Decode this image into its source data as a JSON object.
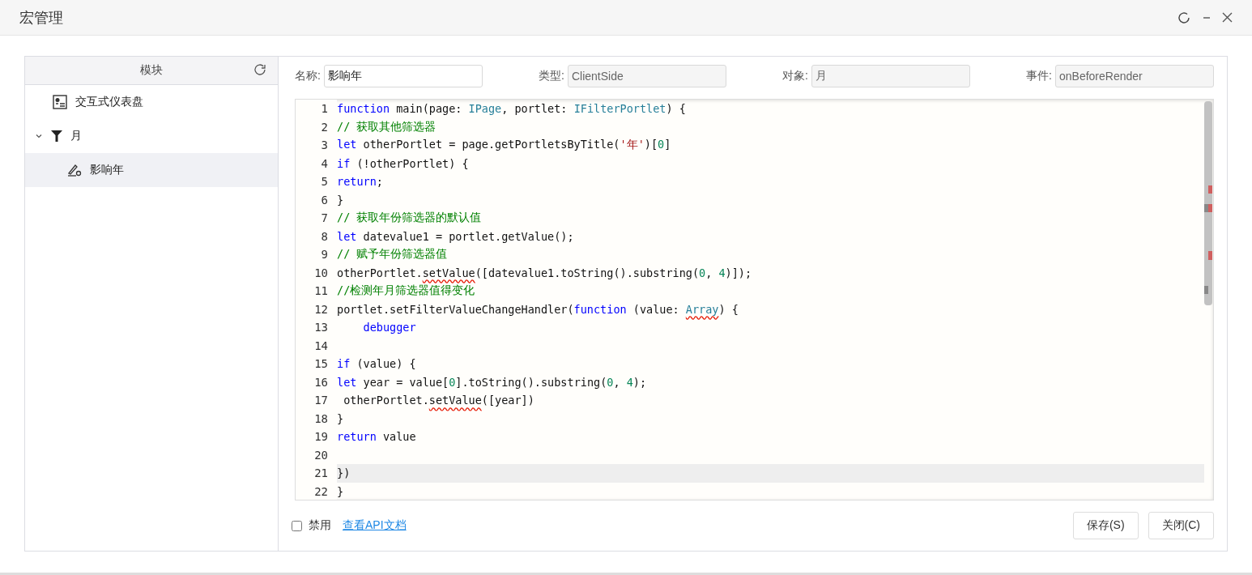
{
  "window": {
    "title": "宏管理"
  },
  "module_panel": {
    "header": "模块",
    "tree": [
      {
        "label": "交互式仪表盘",
        "kind": "dashboard",
        "selected": false
      },
      {
        "label": "月",
        "kind": "filter",
        "selected": false,
        "expanded": true,
        "children": [
          {
            "label": "影响年",
            "kind": "macro",
            "selected": true
          }
        ]
      }
    ]
  },
  "fields": [
    {
      "label": "名称:",
      "value": "影响年",
      "disabled": false
    },
    {
      "label": "类型:",
      "value": "ClientSide",
      "disabled": true
    },
    {
      "label": "对象:",
      "value": "月",
      "disabled": true
    },
    {
      "label": "事件:",
      "value": "onBeforeRender",
      "disabled": true
    }
  ],
  "code_lines": [
    {
      "number": "1",
      "current": false,
      "tokens": [
        {
          "kind": "keyword",
          "text": "function"
        },
        {
          "kind": "plain",
          "text": " main(page: "
        },
        {
          "kind": "type",
          "text": "IPage"
        },
        {
          "kind": "plain",
          "text": ", portlet: "
        },
        {
          "kind": "type",
          "text": "IFilterPortlet"
        },
        {
          "kind": "plain",
          "text": ") {"
        }
      ]
    },
    {
      "number": "2",
      "current": false,
      "tokens": [
        {
          "kind": "comment",
          "text": "// 获取其他筛选器"
        }
      ]
    },
    {
      "number": "3",
      "current": false,
      "tokens": [
        {
          "kind": "keyword",
          "text": "let"
        },
        {
          "kind": "plain",
          "text": " otherPortlet = page.getPortletsByTitle("
        },
        {
          "kind": "string",
          "text": "'年'"
        },
        {
          "kind": "plain",
          "text": ")["
        },
        {
          "kind": "number",
          "text": "0"
        },
        {
          "kind": "plain",
          "text": "]"
        }
      ]
    },
    {
      "number": "4",
      "current": false,
      "tokens": [
        {
          "kind": "keyword",
          "text": "if"
        },
        {
          "kind": "plain",
          "text": " (!otherPortlet) {"
        }
      ]
    },
    {
      "number": "5",
      "current": false,
      "tokens": [
        {
          "kind": "keyword",
          "text": "return"
        },
        {
          "kind": "plain",
          "text": ";"
        }
      ]
    },
    {
      "number": "6",
      "current": false,
      "tokens": [
        {
          "kind": "plain",
          "text": "}"
        }
      ]
    },
    {
      "number": "7",
      "current": false,
      "tokens": [
        {
          "kind": "comment",
          "text": "// 获取年份筛选器的默认值"
        }
      ]
    },
    {
      "number": "8",
      "current": false,
      "tokens": [
        {
          "kind": "keyword",
          "text": "let"
        },
        {
          "kind": "plain",
          "text": " datevalue1 = portlet.getValue();"
        }
      ]
    },
    {
      "number": "9",
      "current": false,
      "tokens": [
        {
          "kind": "comment",
          "text": "// 赋予年份筛选器值"
        }
      ]
    },
    {
      "number": "10",
      "current": false,
      "tokens": [
        {
          "kind": "plain",
          "text": "otherPortlet."
        },
        {
          "kind": "error",
          "text": "setValue"
        },
        {
          "kind": "plain",
          "text": "([datevalue1.toString().substring("
        },
        {
          "kind": "number",
          "text": "0"
        },
        {
          "kind": "plain",
          "text": ", "
        },
        {
          "kind": "number",
          "text": "4"
        },
        {
          "kind": "plain",
          "text": ")]);"
        }
      ]
    },
    {
      "number": "11",
      "current": false,
      "tokens": [
        {
          "kind": "comment",
          "text": "//检测年月筛选器值得变化"
        }
      ]
    },
    {
      "number": "12",
      "current": false,
      "tokens": [
        {
          "kind": "plain",
          "text": "portlet.setFilterValueChangeHandler("
        },
        {
          "kind": "keyword",
          "text": "function"
        },
        {
          "kind": "plain",
          "text": " (value: "
        },
        {
          "kind": "type_error",
          "text": "Array"
        },
        {
          "kind": "plain",
          "text": ") {"
        }
      ]
    },
    {
      "number": "13",
      "current": false,
      "indented": true,
      "tokens": [
        {
          "kind": "keyword",
          "text": "debugger"
        }
      ]
    },
    {
      "number": "14",
      "current": false
    },
    {
      "number": "15",
      "current": false,
      "tokens": [
        {
          "kind": "keyword",
          "text": "if"
        },
        {
          "kind": "plain",
          "text": " (value) {"
        }
      ]
    },
    {
      "number": "16",
      "current": false,
      "tokens": [
        {
          "kind": "keyword",
          "text": "let"
        },
        {
          "kind": "plain",
          "text": " year = value["
        },
        {
          "kind": "number",
          "text": "0"
        },
        {
          "kind": "plain",
          "text": "].toString().substring("
        },
        {
          "kind": "number",
          "text": "0"
        },
        {
          "kind": "plain",
          "text": ", "
        },
        {
          "kind": "number",
          "text": "4"
        },
        {
          "kind": "plain",
          "text": ");"
        }
      ]
    },
    {
      "number": "17",
      "current": false,
      "tokens": [
        {
          "kind": "plain",
          "text": " otherPortlet."
        },
        {
          "kind": "error",
          "text": "setValue"
        },
        {
          "kind": "plain",
          "text": "([year])"
        }
      ]
    },
    {
      "number": "18",
      "current": false,
      "tokens": [
        {
          "kind": "plain",
          "text": "}"
        }
      ]
    },
    {
      "number": "19",
      "current": false,
      "tokens": [
        {
          "kind": "keyword",
          "text": "return"
        },
        {
          "kind": "plain",
          "text": " value"
        }
      ]
    },
    {
      "number": "20",
      "current": false
    },
    {
      "number": "21",
      "current": true,
      "tokens": [
        {
          "kind": "plain",
          "text": "})"
        }
      ]
    },
    {
      "number": "22",
      "current": false,
      "tokens": [
        {
          "kind": "plain",
          "text": "}"
        }
      ]
    }
  ],
  "footer": {
    "disable_checkbox": {
      "label": "禁用",
      "checked": false
    },
    "link": "查看API文档",
    "buttons": [
      "保存(S)",
      "关闭(C)"
    ]
  }
}
